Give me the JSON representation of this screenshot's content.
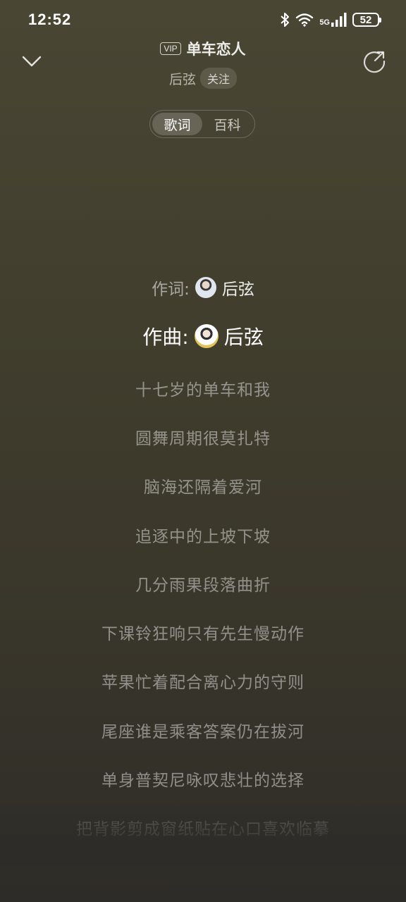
{
  "status_bar": {
    "time": "12:52",
    "network_label": "5G",
    "battery": "52"
  },
  "header": {
    "vip_badge": "VIP",
    "song_title": "单车恋人",
    "artist": "后弦",
    "follow_label": "关注"
  },
  "tabs": [
    {
      "label": "歌词",
      "active": true
    },
    {
      "label": "百科",
      "active": false
    }
  ],
  "credits": {
    "lyricist_label": "作词:",
    "lyricist_name": "后弦",
    "composer_label": "作曲:",
    "composer_name": "后弦"
  },
  "lyrics": [
    "十七岁的单车和我",
    "圆舞周期很莫扎特",
    "脑海还隔着爱河",
    "追逐中的上坡下坡",
    "几分雨果段落曲折",
    "下课铃狂响只有先生慢动作",
    "苹果忙着配合离心力的守则",
    "尾座谁是乘客答案仍在拔河",
    "单身普契尼咏叹悲壮的选择",
    "把背影剪成窗纸贴在心口喜欢临摹"
  ],
  "icons": {
    "collapse": "chevron-down-icon",
    "share": "share-icon",
    "bluetooth": "bluetooth-icon",
    "wifi": "wifi-icon",
    "signal": "signal-icon"
  }
}
